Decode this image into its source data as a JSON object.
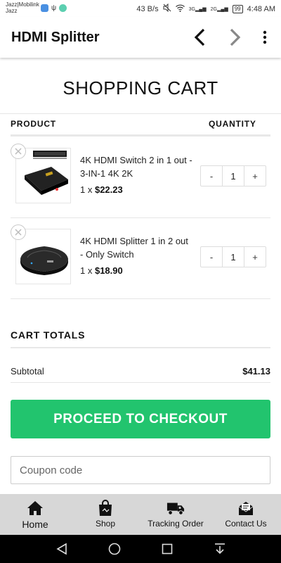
{
  "status_bar": {
    "carrier_line1": "Jazz|Mobilink",
    "carrier_line2": "Jazz",
    "speed": "43 B/s",
    "net1": "3G",
    "net2": "2G",
    "battery": "99",
    "time": "4:48 AM"
  },
  "app_bar": {
    "title": "HDMI Splitter",
    "back_icon": "chevron-left-icon",
    "forward_icon": "chevron-right-icon",
    "more_icon": "more-vert-icon"
  },
  "cart": {
    "title": "SHOPPING CART",
    "headers": {
      "product": "PRODUCT",
      "quantity": "QUANTITY"
    },
    "items": [
      {
        "name": "4K HDMI Switch 2 in 1 out - 3-IN-1 4K 2K",
        "qty_prefix": "1 x ",
        "price": "$22.23",
        "quantity": "1",
        "minus": "-",
        "plus": "+"
      },
      {
        "name": "4K HDMI Splitter 1 in 2 out - Only Switch",
        "qty_prefix": "1 x ",
        "price": "$18.90",
        "quantity": "1",
        "minus": "-",
        "plus": "+"
      }
    ]
  },
  "totals": {
    "title": "CART TOTALS",
    "subtotal_label": "Subtotal",
    "subtotal_value": "$41.13"
  },
  "checkout": {
    "label": "PROCEED TO CHECKOUT",
    "color": "#22c46e"
  },
  "coupon": {
    "placeholder": "Coupon code"
  },
  "bottom_nav": [
    {
      "label": "Home",
      "icon": "home-icon"
    },
    {
      "label": "Shop",
      "icon": "shopping-bag-icon"
    },
    {
      "label": "Tracking Order",
      "icon": "delivery-truck-icon"
    },
    {
      "label": "Contact Us",
      "icon": "envelope-open-icon"
    }
  ],
  "system_nav": [
    "back-triangle-icon",
    "home-circle-icon",
    "recents-square-icon",
    "notifications-pull-icon"
  ]
}
